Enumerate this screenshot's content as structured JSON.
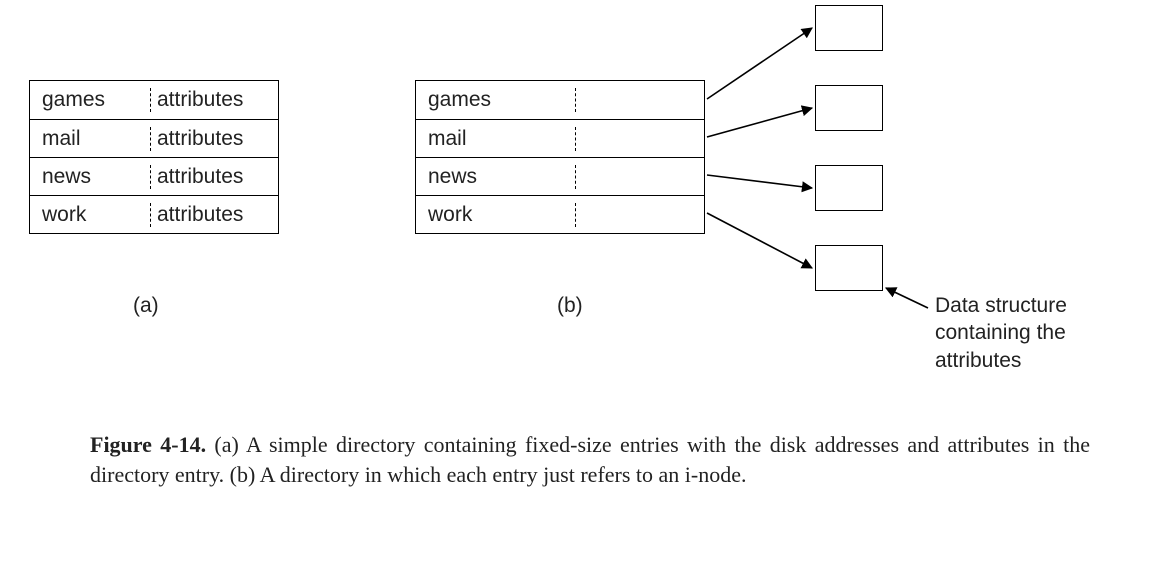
{
  "tableA": {
    "rows": [
      {
        "name": "games",
        "attr": "attributes"
      },
      {
        "name": "mail",
        "attr": "attributes"
      },
      {
        "name": "news",
        "attr": "attributes"
      },
      {
        "name": "work",
        "attr": "attributes"
      }
    ],
    "label": "(a)"
  },
  "tableB": {
    "rows": [
      {
        "name": "games"
      },
      {
        "name": "mail"
      },
      {
        "name": "news"
      },
      {
        "name": "work"
      }
    ],
    "label": "(b)"
  },
  "callout": "Data structure containing the attributes",
  "caption": {
    "figNum": "Figure 4-14.",
    "text": " (a) A simple directory containing fixed-size entries with the disk addresses and attributes in the directory entry. (b) A directory in which each entry just refers to an i-node."
  }
}
